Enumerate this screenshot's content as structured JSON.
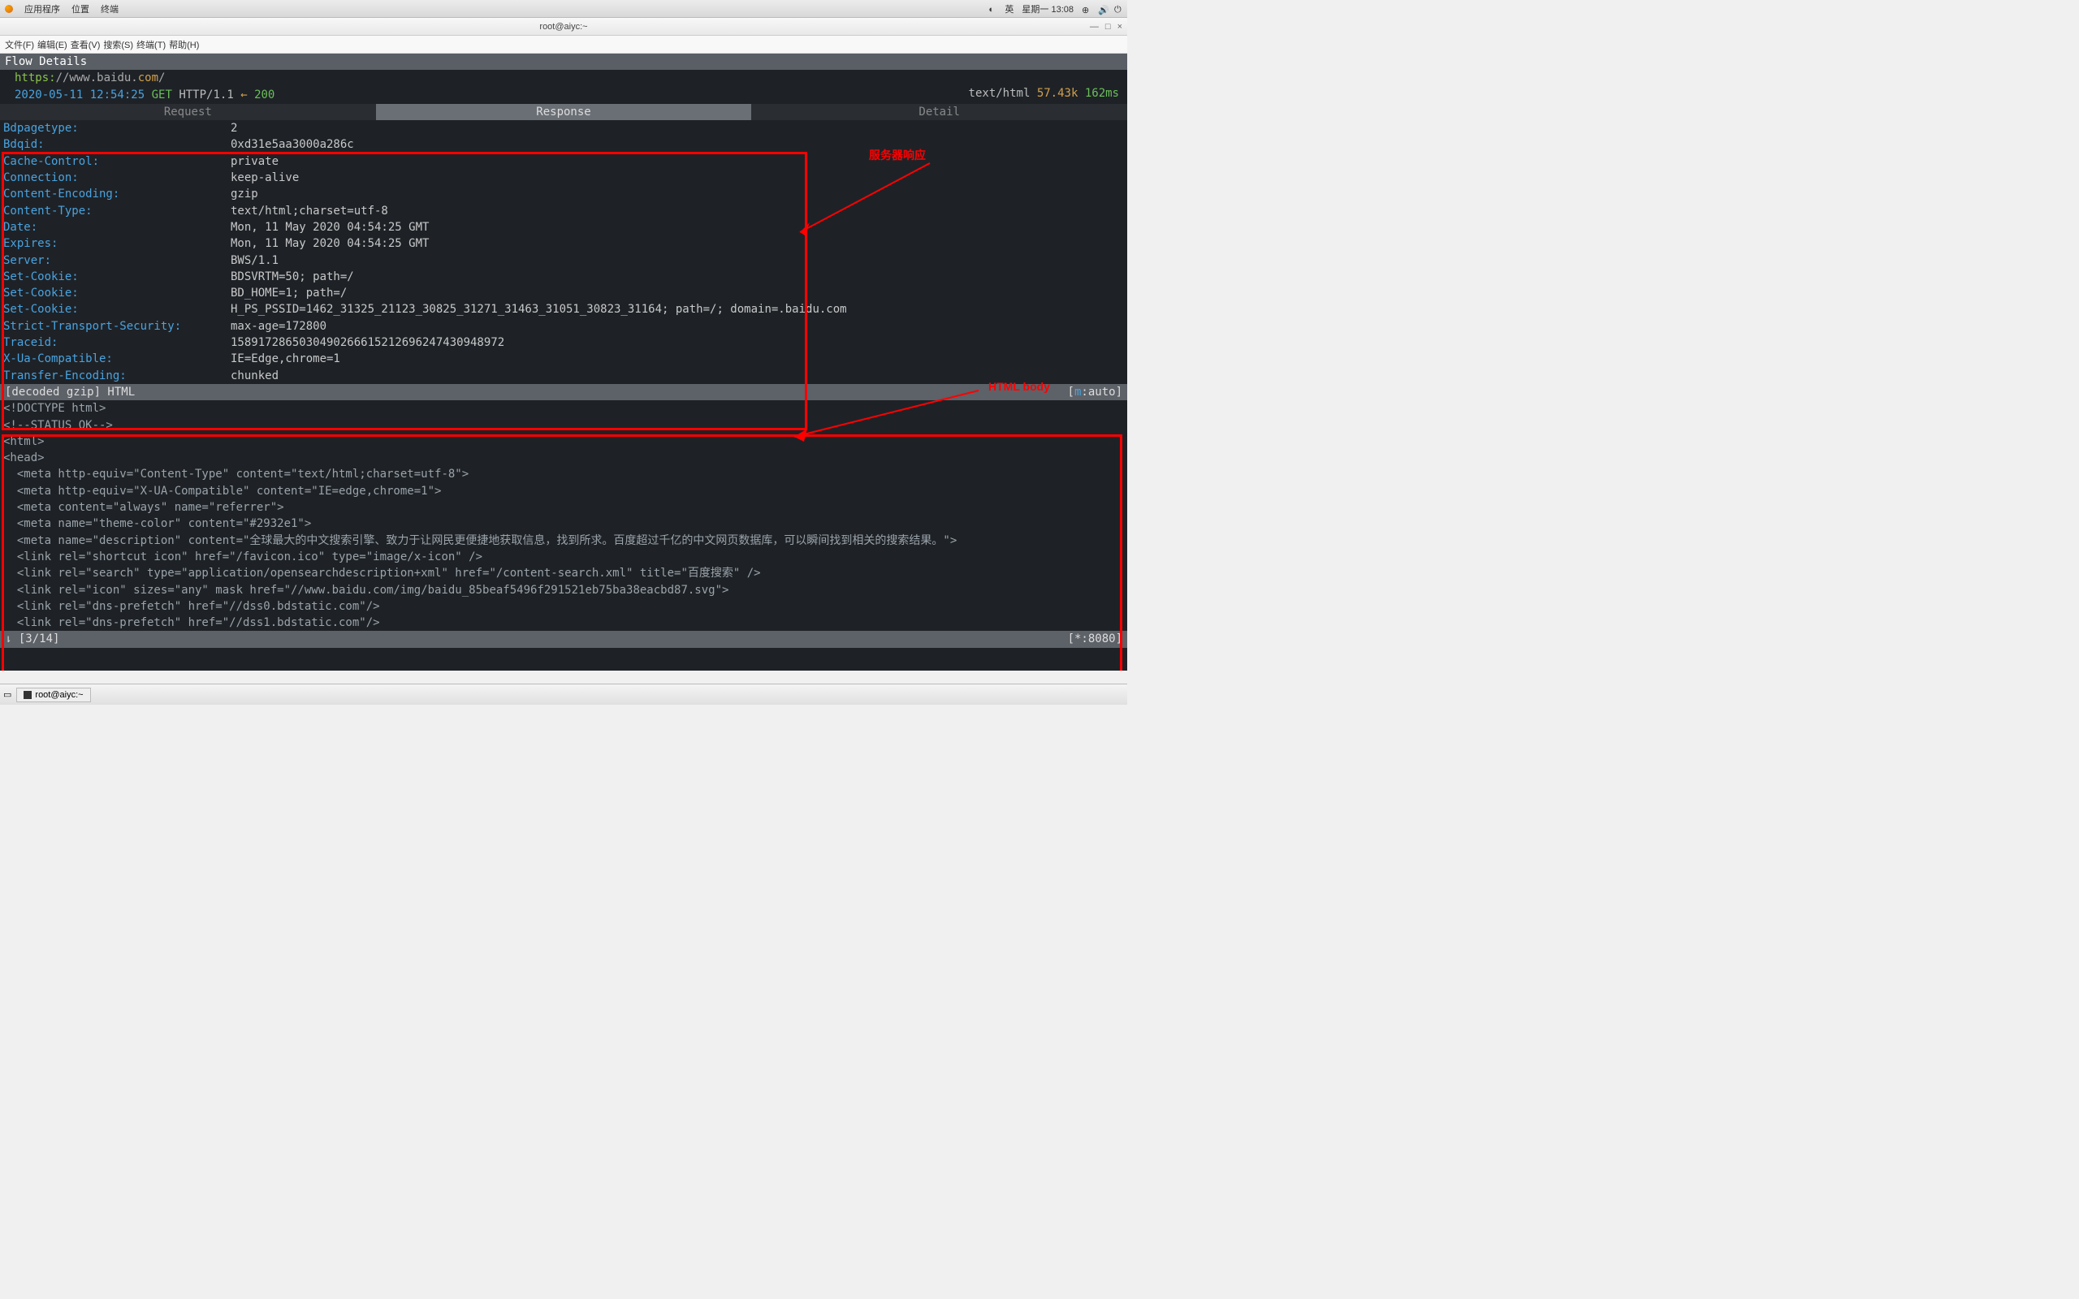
{
  "topbar": {
    "apps": "应用程序",
    "places": "位置",
    "term": "终端",
    "lang": "英",
    "date": "星期一 13:08"
  },
  "titlebar": {
    "title": "root@aiyc:~"
  },
  "menubar": {
    "file": "文件(F)",
    "edit": "编辑(E)",
    "view": "查看(V)",
    "search": "搜索(S)",
    "terminal": "终端(T)",
    "help": "帮助(H)"
  },
  "flow": {
    "title": "Flow Details",
    "scheme": "https:",
    "slashes": "//www.",
    "host": "baidu.",
    "tld": "com",
    "trail": "/",
    "ts": "2020-05-11 12:54:25",
    "method": "GET",
    "proto": "HTTP/1.1",
    "arrow": "←",
    "status": "200",
    "mime": "text/html",
    "size": "57.43k",
    "time": "162ms"
  },
  "tabs": {
    "req": "Request",
    "res": "Response",
    "det": "Detail"
  },
  "headers": [
    {
      "k": "Bdpagetype:",
      "v": "2"
    },
    {
      "k": "Bdqid:",
      "v": "0xd31e5aa3000a286c"
    },
    {
      "k": "Cache-Control:",
      "v": "private"
    },
    {
      "k": "Connection:",
      "v": "keep-alive"
    },
    {
      "k": "Content-Encoding:",
      "v": "gzip"
    },
    {
      "k": "Content-Type:",
      "v": "text/html;charset=utf-8"
    },
    {
      "k": "Date:",
      "v": "Mon, 11 May 2020 04:54:25 GMT"
    },
    {
      "k": "Expires:",
      "v": "Mon, 11 May 2020 04:54:25 GMT"
    },
    {
      "k": "Server:",
      "v": "BWS/1.1"
    },
    {
      "k": "Set-Cookie:",
      "v": "BDSVRTM=50; path=/"
    },
    {
      "k": "Set-Cookie:",
      "v": "BD_HOME=1; path=/"
    },
    {
      "k": "Set-Cookie:",
      "v": "H_PS_PSSID=1462_31325_21123_30825_31271_31463_31051_30823_31164; path=/; domain=.baidu.com"
    },
    {
      "k": "Strict-Transport-Security:",
      "v": "max-age=172800"
    },
    {
      "k": "Traceid:",
      "v": "1589172865030490266615212696247430948972"
    },
    {
      "k": "X-Ua-Compatible:",
      "v": "IE=Edge,chrome=1"
    },
    {
      "k": "Transfer-Encoding:",
      "v": "chunked"
    }
  ],
  "divider": {
    "left": "[decoded gzip] HTML",
    "mode_l": "[",
    "mode_m": "m",
    "mode_r": ":auto]"
  },
  "bodylines": [
    "<!DOCTYPE html>",
    "<!--STATUS OK-->",
    "<html>",
    "<head>",
    "  <meta http-equiv=\"Content-Type\" content=\"text/html;charset=utf-8\">",
    "  <meta http-equiv=\"X-UA-Compatible\" content=\"IE=edge,chrome=1\">",
    "  <meta content=\"always\" name=\"referrer\">",
    "  <meta name=\"theme-color\" content=\"#2932e1\">",
    "  <meta name=\"description\" content=\"全球最大的中文搜索引擎、致力于让网民更便捷地获取信息，找到所求。百度超过千亿的中文网页数据库，可以瞬间找到相关的搜索结果。\">",
    "  <link rel=\"shortcut icon\" href=\"/favicon.ico\" type=\"image/x-icon\" />",
    "  <link rel=\"search\" type=\"application/opensearchdescription+xml\" href=\"/content-search.xml\" title=\"百度搜索\" />",
    "  <link rel=\"icon\" sizes=\"any\" mask href=\"//www.baidu.com/img/baidu_85beaf5496f291521eb75ba38eacbd87.svg\">",
    "  <link rel=\"dns-prefetch\" href=\"//dss0.bdstatic.com\"/>",
    "  <link rel=\"dns-prefetch\" href=\"//dss1.bdstatic.com\"/>"
  ],
  "status": {
    "left": "⇂ [3/14]",
    "right": "[*:8080]"
  },
  "ann": {
    "resp": "服务器响应",
    "body": "HTML body"
  },
  "task": {
    "app": "root@aiyc:~"
  }
}
